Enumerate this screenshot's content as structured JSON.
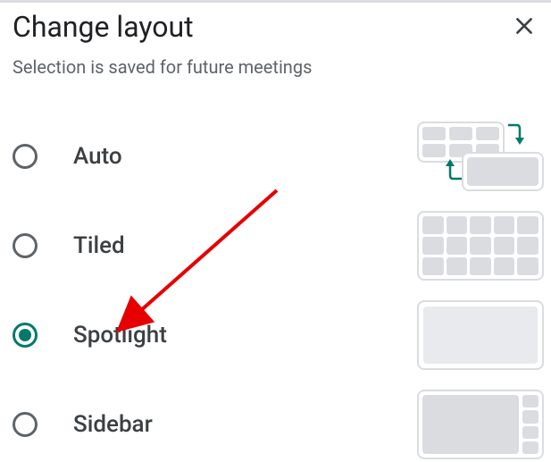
{
  "dialog": {
    "title": "Change layout",
    "subtitle": "Selection is saved for future meetings"
  },
  "options": [
    {
      "id": "auto",
      "label": "Auto",
      "selected": false,
      "thumb": "auto"
    },
    {
      "id": "tiled",
      "label": "Tiled",
      "selected": false,
      "thumb": "tiled"
    },
    {
      "id": "spotlight",
      "label": "Spotlight",
      "selected": true,
      "thumb": "spotlight"
    },
    {
      "id": "sidebar",
      "label": "Sidebar",
      "selected": false,
      "thumb": "sidebar"
    }
  ],
  "annotation": {
    "type": "arrow",
    "color": "#e60000",
    "target_option": "spotlight"
  }
}
